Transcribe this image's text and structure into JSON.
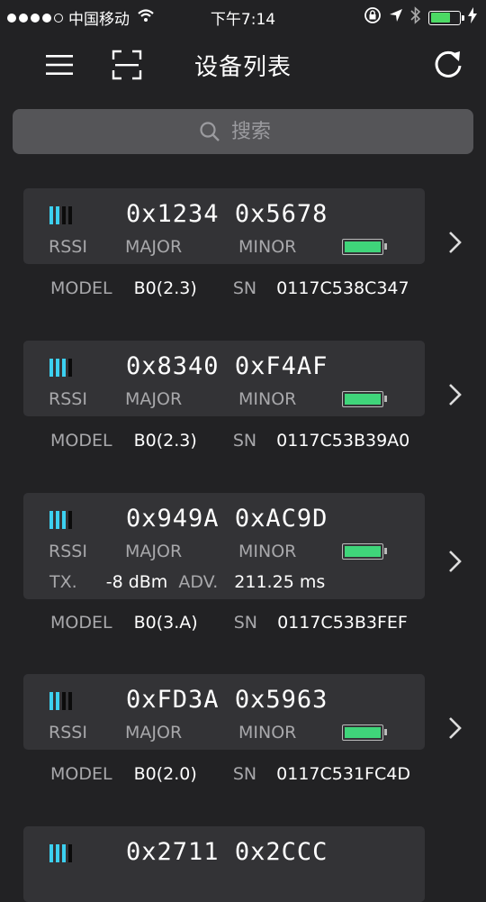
{
  "status_bar": {
    "carrier": "中国移动",
    "time": "下午7:14",
    "signal_icon": "cellular-signal-icon",
    "wifi_icon": "wifi-icon",
    "battery_level": 0.7
  },
  "navbar": {
    "title": "设备列表",
    "menu_icon": "menu-icon",
    "scan_icon": "scan-icon",
    "refresh_icon": "refresh-icon"
  },
  "search": {
    "placeholder": "搜索",
    "value": ""
  },
  "labels": {
    "rssi": "RSSI",
    "major": "MAJOR",
    "minor": "MINOR",
    "model": "MODEL",
    "sn": "SN",
    "tx": "TX.",
    "adv": "ADV."
  },
  "devices": [
    {
      "major": "0x1234",
      "minor": "0x5678",
      "rssi_bars": 2,
      "battery_level": 1.0,
      "model": "B0(2.3)",
      "sn": "0117C538C347"
    },
    {
      "major": "0x8340",
      "minor": "0xF4AF",
      "rssi_bars": 3,
      "battery_level": 1.0,
      "model": "B0(2.3)",
      "sn": "0117C53B39A0"
    },
    {
      "major": "0x949A",
      "minor": "0xAC9D",
      "rssi_bars": 3,
      "battery_level": 1.0,
      "tx": "-8 dBm",
      "adv": "211.25 ms",
      "model": "B0(3.A)",
      "sn": "0117C53B3FEF"
    },
    {
      "major": "0xFD3A",
      "minor": "0x5963",
      "rssi_bars": 2,
      "battery_level": 1.0,
      "model": "B0(2.0)",
      "sn": "0117C531FC4D"
    },
    {
      "major": "0x2711",
      "minor": "0x2CCC",
      "rssi_bars": 3
    }
  ],
  "colors": {
    "background": "#222224",
    "card": "#333336",
    "rssi_on": "#3cd0f0",
    "battery": "#3fd57a",
    "label": "#a8a8ab"
  }
}
